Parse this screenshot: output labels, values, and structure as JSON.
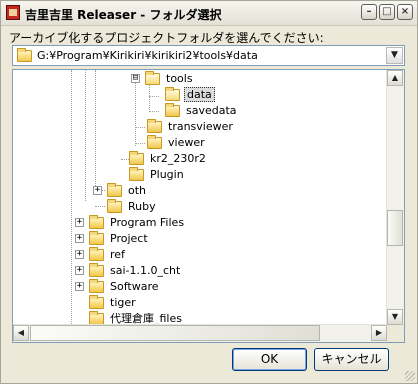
{
  "window": {
    "title": "吉里吉里 Releaser - フォルダ選択",
    "minimize_glyph": "–",
    "maximize_glyph": "□",
    "close_glyph": "×"
  },
  "prompt": "アーカイブ化するプロジェクトフォルダを選んでください:",
  "path_combo": {
    "value": "G:¥Program¥Kirikiri¥kirikiri2¥tools¥data",
    "arrow_glyph": "▼"
  },
  "tree": {
    "nodes": [
      {
        "label": "tools",
        "expander": "⊟",
        "open": true
      },
      {
        "label": "data",
        "selected": true,
        "open": true
      },
      {
        "label": "savedata"
      },
      {
        "label": "transviewer"
      },
      {
        "label": "viewer"
      },
      {
        "label": "kr2_230r2"
      },
      {
        "label": "Plugin"
      },
      {
        "label": "oth",
        "expander": "+"
      },
      {
        "label": "Ruby"
      },
      {
        "label": "Program Files",
        "expander": "+"
      },
      {
        "label": "Project",
        "expander": "+"
      },
      {
        "label": "ref",
        "expander": "+"
      },
      {
        "label": "sai-1.1.0_cht",
        "expander": "+"
      },
      {
        "label": "Software",
        "expander": "+"
      },
      {
        "label": "tiger"
      },
      {
        "label": "代理倉庫_files"
      }
    ]
  },
  "scrollbar": {
    "up_glyph": "▲",
    "down_glyph": "▼",
    "left_glyph": "◀",
    "right_glyph": "▶"
  },
  "buttons": {
    "ok": "OK",
    "cancel": "キャンセル"
  }
}
